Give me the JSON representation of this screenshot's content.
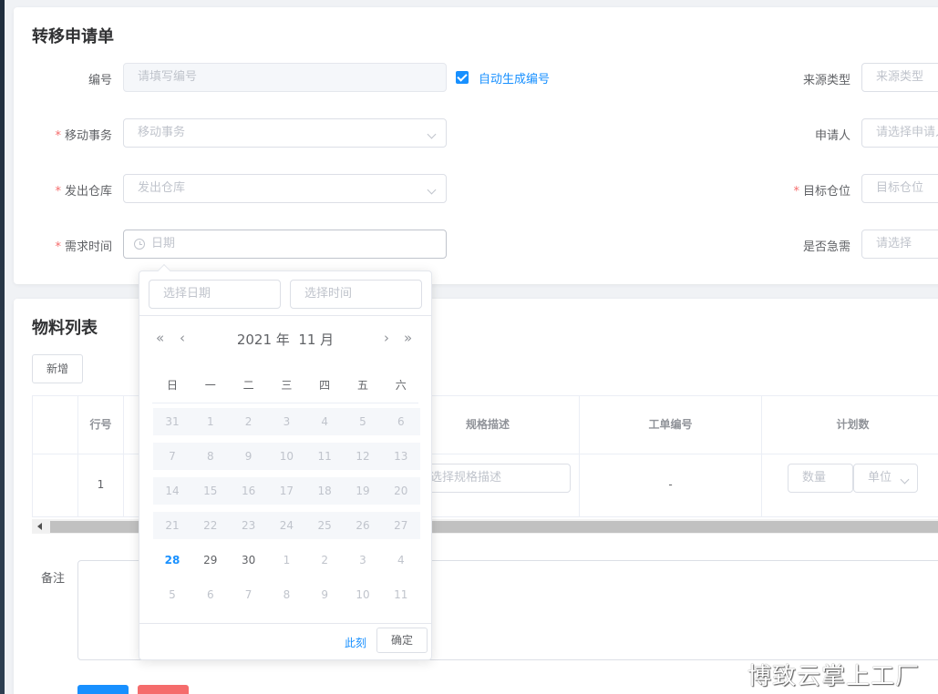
{
  "form": {
    "title": "转移申请单",
    "code": {
      "label": "编号",
      "placeholder": "请填写编号",
      "auto_label": "自动生成编号"
    },
    "source_type": {
      "label": "来源类型",
      "placeholder": "来源类型"
    },
    "move_matter": {
      "label": "移动事务",
      "placeholder": "移动事务"
    },
    "applicant": {
      "label": "申请人",
      "placeholder": "请选择申请人"
    },
    "from_warehouse": {
      "label": "发出仓库",
      "placeholder": "发出仓库"
    },
    "target_location": {
      "label": "目标仓位",
      "placeholder": "目标仓位"
    },
    "need_time": {
      "label": "需求时间",
      "placeholder": "日期"
    },
    "urgent": {
      "label": "是否急需",
      "placeholder": "请选择"
    },
    "required_mark": "*"
  },
  "materials": {
    "title": "物料列表",
    "add_button": "新增",
    "columns": [
      "行号",
      "规格描述",
      "工单编号",
      "计划数"
    ],
    "row": {
      "line_no": "1",
      "spec_placeholder": "选择规格描述",
      "work_order": "-",
      "qty_placeholder": "数量",
      "unit_placeholder": "单位"
    },
    "remark_label": "备注"
  },
  "picker": {
    "date_placeholder": "选择日期",
    "time_placeholder": "选择时间",
    "year_label": "2021 年",
    "month_label": "11 月",
    "nav": {
      "prev_year": "«",
      "prev_month": "‹",
      "next_month": "›",
      "next_year": "»"
    },
    "weekdays": [
      "日",
      "一",
      "二",
      "三",
      "四",
      "五",
      "六"
    ],
    "weeks": [
      [
        "31",
        "1",
        "2",
        "3",
        "4",
        "5",
        "6"
      ],
      [
        "7",
        "8",
        "9",
        "10",
        "11",
        "12",
        "13"
      ],
      [
        "14",
        "15",
        "16",
        "17",
        "18",
        "19",
        "20"
      ],
      [
        "21",
        "22",
        "23",
        "24",
        "25",
        "26",
        "27"
      ],
      [
        "28",
        "29",
        "30",
        "1",
        "2",
        "3",
        "4"
      ],
      [
        "5",
        "6",
        "7",
        "8",
        "9",
        "10",
        "11"
      ]
    ],
    "today_day": "28",
    "now_label": "此刻",
    "confirm_label": "确定"
  },
  "watermark": "博致云掌上工厂",
  "colors": {
    "primary": "#1890ff",
    "danger": "#f56c6c",
    "required": "#f56c6c"
  }
}
